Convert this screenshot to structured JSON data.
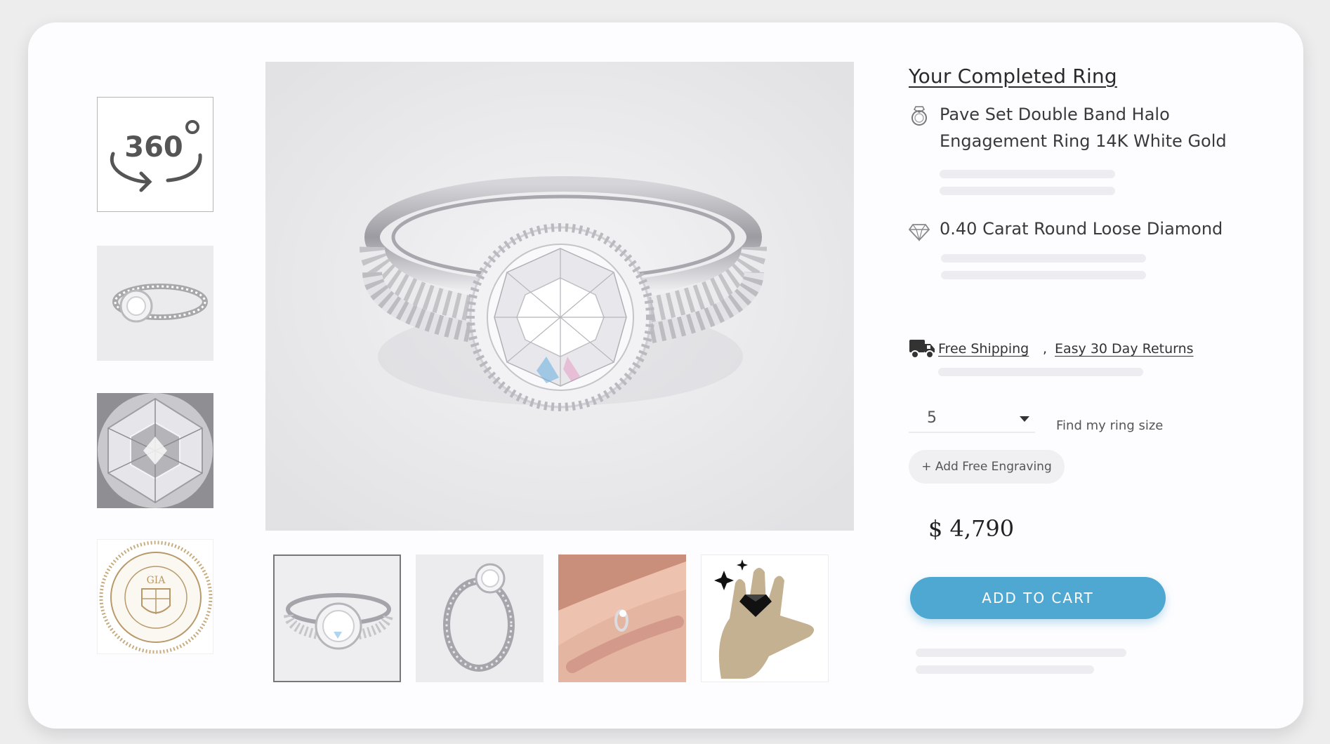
{
  "product": {
    "section_title": "Your Completed Ring",
    "setting": {
      "name": "Pave Set Double Band Halo Engagement Ring 14K White Gold",
      "icon": "ring-icon"
    },
    "diamond": {
      "name": "0.40 Carat Round Loose Diamond",
      "icon": "diamond-icon"
    },
    "shipping": {
      "icon": "truck-icon",
      "free_shipping": "Free Shipping",
      "separator": ",",
      "returns": "Easy 30 Day Returns"
    },
    "ring_size": {
      "selected": "5",
      "find_link": "Find my ring size"
    },
    "engraving_button": "+ Add Free Engraving",
    "price": "$ 4,790",
    "add_to_cart": "ADD TO CART"
  },
  "gallery": {
    "badge_360": "360",
    "certificate_seal": "GIA",
    "thumbnails_left": [
      "360-view",
      "ring-side-view",
      "diamond-closeup",
      "gia-certificate"
    ],
    "thumbnails_bottom": [
      "ring-front-view",
      "ring-angle-view",
      "ring-on-hand",
      "hand-size-guide"
    ],
    "colors": {
      "accent_button": "#4fa8d2",
      "hand_fill": "#c4b192",
      "seal_gold": "#b8996a"
    }
  }
}
